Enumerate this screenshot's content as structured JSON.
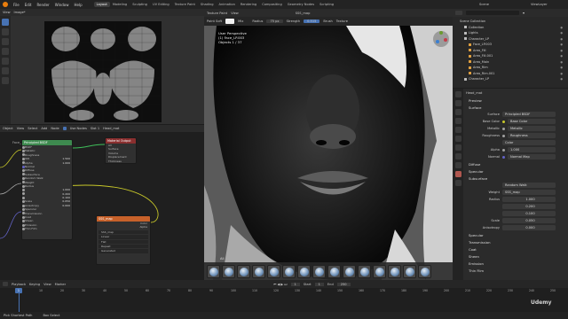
{
  "app": {
    "menu": [
      "File",
      "Edit",
      "Render",
      "Window",
      "Help"
    ],
    "workspaces": [
      "Layout",
      "Modeling",
      "Sculpting",
      "UV Editing",
      "Texture Paint",
      "Shading",
      "Animation",
      "Rendering",
      "Compositing",
      "Geometry Nodes",
      "Scripting"
    ],
    "active_workspace": "Layout",
    "scene": "Scene",
    "view_layer": "ViewLayer"
  },
  "image_editor": {
    "view_label": "View",
    "image_label": "Image*"
  },
  "viewport": {
    "mode": "Texture Paint",
    "view_label": "View",
    "header_title": "SSS_map",
    "tool_label": "Paint Soft",
    "blend_mode": "Mix",
    "radius_label": "Radius",
    "radius_value": "75 px",
    "strength_label": "Strength",
    "strength_value": "0.515",
    "brush_menu": "Brush",
    "texture_menu": "Texture",
    "info_line1": "User Perspective",
    "info_line2": "(1) Face_LP.003",
    "info_line3": "Objects    1 / 37",
    "brush_bar_label": "All"
  },
  "node_editor": {
    "menu": [
      "Object",
      "View",
      "Select",
      "Add",
      "Node"
    ],
    "use_nodes_label": "Use Nodes",
    "slot_label": "Slot 1",
    "material": "Head_mat",
    "breadcrumb": "Face_LP.003  >  Head_mat",
    "principled": {
      "title": "Principled BSDF",
      "rows": [
        {
          "label": "BSDF",
          "value": ""
        },
        {
          "label": "Metallic",
          "value": ""
        },
        {
          "label": "Roughness",
          "value": ""
        },
        {
          "label": "IOR",
          "value": "1.500"
        },
        {
          "label": "Alpha",
          "value": "1.000"
        },
        {
          "label": "Normal",
          "value": ""
        },
        {
          "label": "Diffuse",
          "value": ""
        },
        {
          "label": "Subsurface",
          "value": ""
        },
        {
          "label": "Random Walk",
          "value": ""
        },
        {
          "label": "Weight",
          "value": ""
        },
        {
          "label": "Radius",
          "value": ""
        },
        {
          "label": "",
          "value": "1.000"
        },
        {
          "label": "",
          "value": "0.200"
        },
        {
          "label": "",
          "value": "0.100"
        },
        {
          "label": "Scale",
          "value": "0.050"
        },
        {
          "label": "Anisotropy",
          "value": "0.000"
        },
        {
          "label": "Specular",
          "value": ""
        },
        {
          "label": "Transmission",
          "value": ""
        },
        {
          "label": "Coat",
          "value": ""
        },
        {
          "label": "Sheen",
          "value": ""
        },
        {
          "label": "Emission",
          "value": ""
        },
        {
          "label": "Thin Film",
          "value": ""
        }
      ]
    },
    "output": {
      "title": "Material Output",
      "selector": "All",
      "rows": [
        "Surface",
        "Volume",
        "Displacement",
        "Thickness"
      ]
    },
    "image_tex": {
      "title": "SSS_map",
      "rows": [
        "Color",
        "Alpha",
        "SSS_map",
        "Linear",
        "Flat",
        "Repeat",
        "Generated"
      ]
    }
  },
  "timeline": {
    "menu": [
      "Playback",
      "Keying",
      "View",
      "Marker"
    ],
    "current_frame": "1",
    "start_label": "Start",
    "start_value": "1",
    "end_label": "End",
    "end_value": "250",
    "ticks": [
      "0",
      "10",
      "20",
      "30",
      "40",
      "50",
      "60",
      "70",
      "80",
      "90",
      "100",
      "110",
      "120",
      "130",
      "140",
      "150",
      "160",
      "170",
      "180",
      "190",
      "200",
      "210",
      "220",
      "230",
      "240",
      "250"
    ]
  },
  "statusbar": {
    "left": "Pick Shortest Path",
    "middle": "Box Select",
    "right": "Udemy"
  },
  "outliner": {
    "title": "Scene Collection",
    "items": [
      {
        "name": "Collection",
        "indent": 1,
        "color": "#bdbdbd"
      },
      {
        "name": "Lights",
        "indent": 1,
        "color": "#bdbdbd"
      },
      {
        "name": "Character_LP",
        "indent": 1,
        "color": "#bdbdbd"
      },
      {
        "name": "Face_LP.003",
        "indent": 2,
        "color": "#e0a040"
      },
      {
        "name": "Area_Fill",
        "indent": 2,
        "color": "#e0a040"
      },
      {
        "name": "Area_Fill.001",
        "indent": 2,
        "color": "#e0a040"
      },
      {
        "name": "Area_Main",
        "indent": 2,
        "color": "#e0a040"
      },
      {
        "name": "Area_Rim",
        "indent": 2,
        "color": "#e0a040"
      },
      {
        "name": "Area_Rim.001",
        "indent": 2,
        "color": "#e0a040"
      },
      {
        "name": "Character_LP",
        "indent": 1,
        "color": "#bdbdbd"
      }
    ]
  },
  "properties": {
    "material_name": "Head_mat",
    "sections_top": [
      "Preview",
      "Surface"
    ],
    "surface_label": "Surface",
    "surface_value": "Principled BSDF",
    "rows": [
      {
        "label": "Base Color",
        "value": "Base Color",
        "dot": "#c7c729"
      },
      {
        "label": "Metallic",
        "value": "Metallic",
        "dot": "#a1a1a1"
      },
      {
        "label": "Roughness",
        "value": "Roughness",
        "dot": "#a1a1a1"
      },
      {
        "label": "",
        "value": "Color",
        "dot": ""
      },
      {
        "label": "Alpha",
        "value": "1.000",
        "dot": "#a1a1a1"
      },
      {
        "label": "Normal",
        "value": "Normal Map",
        "dot": "#6363c7"
      }
    ],
    "sections_mid": [
      "Diffuse",
      "Specular",
      "Subsurface"
    ],
    "subsurface_method": "Random Walk",
    "weight_label": "Weight",
    "weight_value": "SSS_map",
    "radius_label": "Radius",
    "radius_values": [
      "1.000",
      "0.200",
      "0.100"
    ],
    "scale_label": "Scale",
    "scale_value": "0.050",
    "anisotropy_label": "Anisotropy",
    "anisotropy_value": "0.000",
    "sections_bottom": [
      "Specular",
      "Transmission",
      "Coat",
      "Sheen",
      "Emission",
      "Thin Film"
    ]
  },
  "colors": {
    "accent": "#4772b3",
    "blender_orange": "#e87d0d",
    "node_shader_header": "#3e8a4f",
    "node_output_header": "#8a2f2f",
    "node_texture_header": "#c7612a"
  }
}
